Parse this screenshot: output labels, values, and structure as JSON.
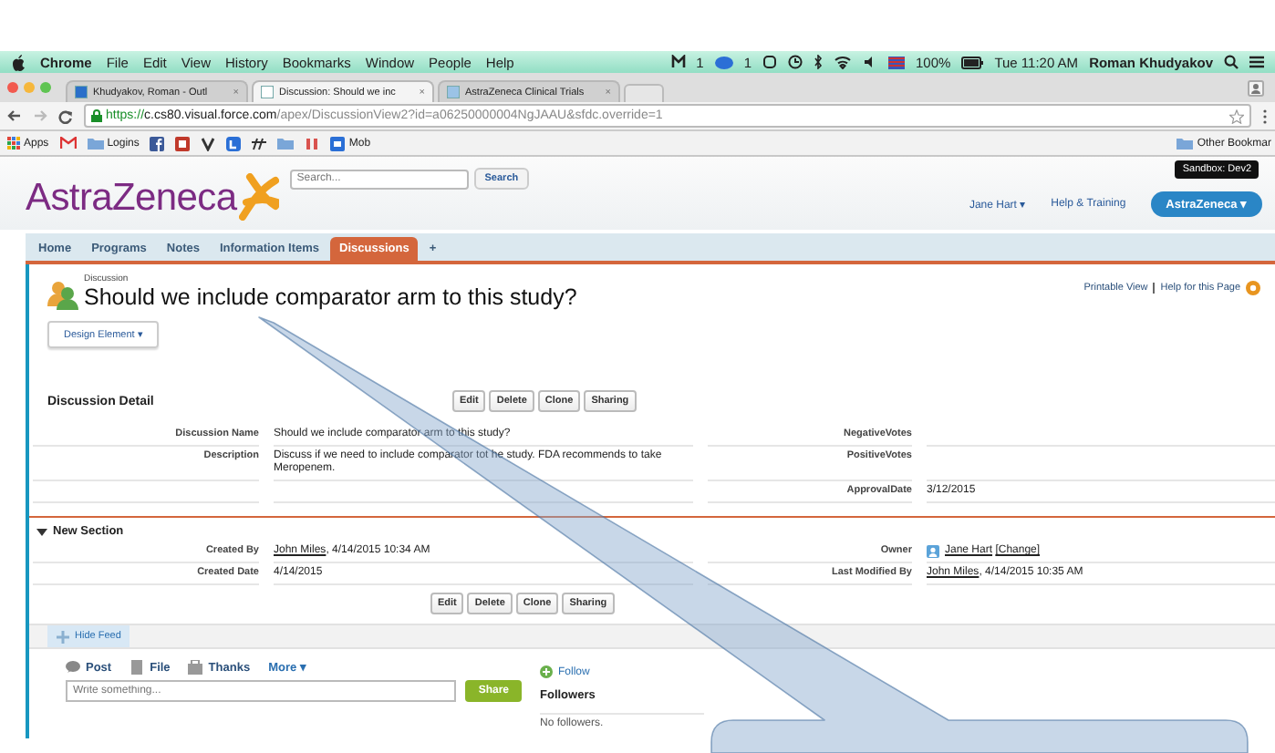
{
  "menu_bar": {
    "app": "Chrome",
    "items": [
      "File",
      "Edit",
      "View",
      "History",
      "Bookmarks",
      "Window",
      "People",
      "Help"
    ],
    "status": [
      "1",
      "1",
      "100%"
    ],
    "clock": "Tue 11:20 AM",
    "user": "Roman Khudyakov"
  },
  "browser_tabs": [
    {
      "title": "Khudyakov, Roman - Outl",
      "close": "×",
      "selected": false
    },
    {
      "title": "Discussion: Should we inc",
      "close": "×",
      "selected": true
    },
    {
      "title": "AstraZeneca Clinical Trials",
      "close": "×",
      "selected": false
    }
  ],
  "address": {
    "scheme": "https://",
    "host": "c.cs80.visual.force.com",
    "path": "/apex/DiscussionView2?id=a06250000004NgJAAU&sfdc.override=1"
  },
  "bookmarks": {
    "apps": "Apps",
    "folders": [
      "Logins"
    ],
    "last": "Mob",
    "other": "Other Bookmar"
  },
  "sandbox": "Sandbox: Dev2",
  "header": {
    "logo": "AstraZeneca",
    "search_placeholder": "Search...",
    "search_button": "Search",
    "user": "Jane Hart ▾",
    "help": "Help & Training",
    "app_menu": "AstraZeneca ▾"
  },
  "tabs": [
    {
      "label": "Home",
      "selected": false
    },
    {
      "label": "Programs",
      "selected": false
    },
    {
      "label": "Notes",
      "selected": false
    },
    {
      "label": "Information Items",
      "selected": false
    },
    {
      "label": "Discussions",
      "selected": true
    }
  ],
  "add_tab": "+",
  "record": {
    "type": "Discussion",
    "title": "Should we include comparator arm to this study?",
    "printable": "Printable View",
    "help": "Help for this Page",
    "dropdown": "Design Element ▾"
  },
  "detail": {
    "heading": "Discussion Detail",
    "buttons": [
      "Edit",
      "Delete",
      "Clone",
      "Sharing"
    ],
    "rows": [
      {
        "left": {
          "label": "Discussion Name",
          "value": {
            "text": "Should we include comparator arm to this study?"
          }
        },
        "right": {
          "label": "NegativeVotes"
        }
      },
      {
        "left": {
          "label": "Description",
          "value": {
            "text": "Discuss if we need to include comparator tot he study. FDA recommends to take Meropenem."
          }
        },
        "right": {
          "label": "PositiveVotes"
        }
      },
      {
        "right": {
          "label": "ApprovalDate",
          "value": {
            "text": "3/12/2015"
          }
        }
      }
    ]
  },
  "section": {
    "title": "New Section",
    "expanded": true,
    "buttons": [
      "Edit",
      "Delete",
      "Clone",
      "Sharing"
    ],
    "rows": [
      {
        "left": {
          "label": "Created By",
          "value": {
            "links": [
              "John Miles"
            ],
            "text": ", 4/14/2015 10:34 AM"
          }
        },
        "right": {
          "label": "Owner",
          "icon": true,
          "value": {
            "links": [
              "Jane Hart",
              "[Change]"
            ]
          }
        }
      },
      {
        "left": {
          "label": "Created Date",
          "value": {
            "text": "4/14/2015"
          }
        },
        "right": {
          "label": "Last Modified By",
          "value": {
            "links": [
              "John Miles"
            ],
            "text": ", 4/14/2015 10:35 AM"
          }
        }
      }
    ]
  },
  "feed": {
    "hide": "Hide Feed",
    "actions": [
      "Post",
      "File",
      "Thanks"
    ],
    "more": "More ▾",
    "placeholder": "Write something...",
    "share": "Share",
    "follow": "Follow",
    "followers": "Followers",
    "no_followers": "No followers."
  }
}
